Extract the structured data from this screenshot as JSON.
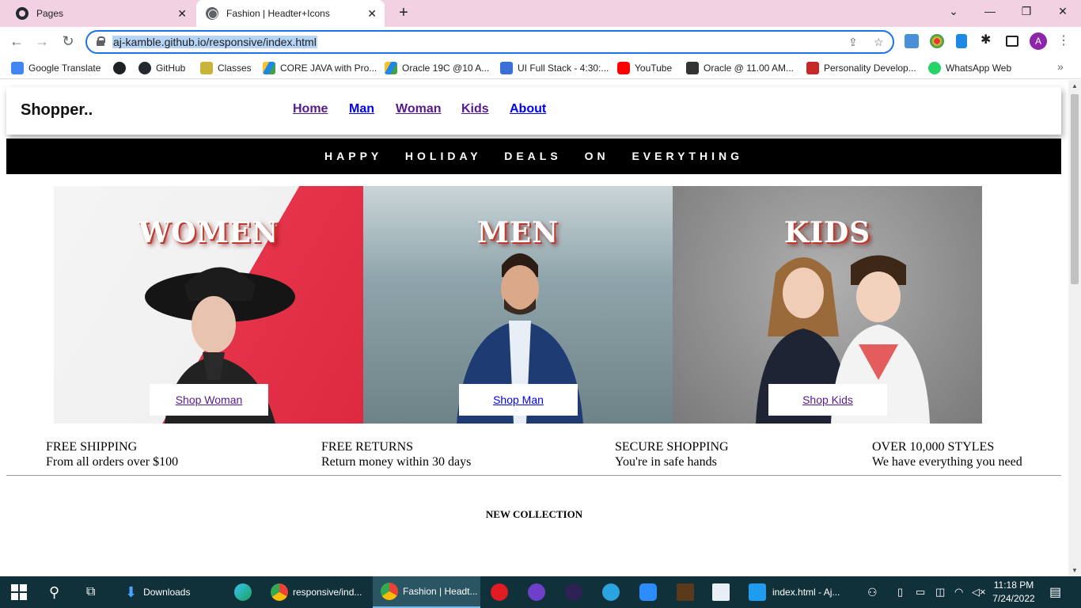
{
  "browser": {
    "tabs": [
      {
        "title": "Pages",
        "icon": "github-icon"
      },
      {
        "title": "Fashion | Headter+Icons",
        "icon": "globe-icon",
        "active": true
      }
    ],
    "new_tab": "+",
    "window_controls": {
      "minimize": "—",
      "restore": "❐",
      "close": "✕",
      "tab_search": "⌄"
    },
    "url": "aj-kamble.github.io/responsive/index.html",
    "profile_initial": "A",
    "bookmarks": [
      "Google Translate",
      "",
      "GitHub",
      "Classes",
      "CORE JAVA with Pro...",
      "Oracle 19C @10 A...",
      "UI Full Stack - 4:30:...",
      "YouTube",
      "Oracle @ 11.00 AM...",
      "Personality Develop...",
      "WhatsApp Web"
    ],
    "bookmarks_more": "»"
  },
  "site": {
    "logo": "Shopper..",
    "nav": [
      "Home",
      "Man",
      "Woman",
      "Kids",
      "About"
    ],
    "promo": "HAPPY HOLIDAY DEALS ON EVERYTHING",
    "cards": [
      {
        "title": "WOMEN",
        "button": "Shop Woman"
      },
      {
        "title": "MEN",
        "button": "Shop Man"
      },
      {
        "title": "KIDS",
        "button": "Shop Kids"
      }
    ],
    "features": [
      {
        "title": "FREE SHIPPING",
        "sub": "From all orders over $100"
      },
      {
        "title": "FREE RETURNS",
        "sub": "Return money within 30 days"
      },
      {
        "title": "SECURE SHOPPING",
        "sub": "You're in safe hands"
      },
      {
        "title": "OVER 10,000 STYLES",
        "sub": "We have everything you need"
      }
    ],
    "collection_heading": "NEW COLLECTION"
  },
  "taskbar": {
    "items": [
      "Downloads",
      "responsive/ind...",
      "Fashion | Headt...",
      "index.html - Aj..."
    ],
    "time": "11:18 PM",
    "date": "7/24/2022"
  },
  "colors": {
    "tabstrip": "#f2d1e3",
    "link": "#0000ee",
    "visited_link": "#551a8b",
    "accent": "#1a73e8",
    "taskbar": "#10303a"
  }
}
